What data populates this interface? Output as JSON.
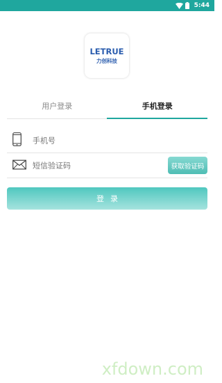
{
  "status_bar": {
    "time": "5:44",
    "icons": [
      "wifi-icon",
      "battery-icon"
    ],
    "color": "#1fa79e"
  },
  "logo": {
    "brand_en": "LETRUE",
    "brand_cn": "力创科技",
    "color": "#2a5cae"
  },
  "tabs": [
    {
      "label": "用户登录",
      "active": false
    },
    {
      "label": "手机登录",
      "active": true
    }
  ],
  "phone_field": {
    "icon": "phone-icon",
    "placeholder": "手机号",
    "value": ""
  },
  "code_field": {
    "icon": "envelope-icon",
    "placeholder": "短信验证码",
    "value": "",
    "button_label": "获取验证码"
  },
  "login_button": {
    "label": "登录"
  },
  "watermark": "xfdown.com",
  "accent_color": "#1fa79e"
}
